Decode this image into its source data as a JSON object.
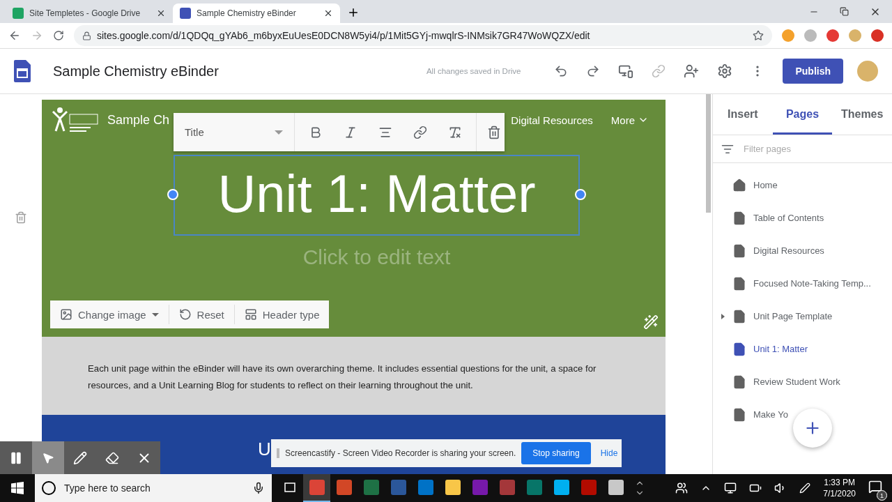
{
  "browser": {
    "tabs": [
      {
        "title": "Site Templetes - Google Drive",
        "kind": "drive",
        "selected": false
      },
      {
        "title": "Sample Chemistry eBinder",
        "kind": "sites",
        "selected": true
      }
    ],
    "url": "sites.google.com/d/1QDQq_gYAb6_m6byxEuUesE0DCN8W5yi4/p/1Mit5GYj-mwqlrS-INMsik7GR47WoWQZX/edit"
  },
  "site_header": {
    "title": "Sample Chemistry eBinder",
    "save_status": "All changes saved in Drive",
    "publish": "Publish"
  },
  "editor": {
    "site_title": "Sample Ch",
    "nav_links": [
      "Digital Resources"
    ],
    "more": "More",
    "format_toolbar": {
      "style": "Title"
    },
    "header": {
      "title": "Unit 1: Matter",
      "subtitle_placeholder": "Click to edit text",
      "buttons": [
        {
          "label": "Change image",
          "kind": "image"
        },
        {
          "label": "Reset",
          "kind": "reset"
        },
        {
          "label": "Header type",
          "kind": "header"
        }
      ]
    },
    "intro_text": "Each unit page within the eBinder will have its own overarching theme. It includes essential questions for the unit, a space for resources, and a Unit Learning Blog for students to reflect on their learning throughout the unit.",
    "section_title": "U"
  },
  "panel": {
    "tabs": [
      {
        "label": "Insert",
        "selected": false
      },
      {
        "label": "Pages",
        "selected": true
      },
      {
        "label": "Themes",
        "selected": false
      }
    ],
    "filter": {
      "placeholder": "Filter pages"
    },
    "pages": [
      {
        "label": "Home",
        "kind": "home",
        "selected": false
      },
      {
        "label": "Table of Contents",
        "kind": "page",
        "selected": false
      },
      {
        "label": "Digital Resources",
        "kind": "page",
        "selected": false
      },
      {
        "label": "Focused Note-Taking Temp...",
        "kind": "page",
        "selected": false
      },
      {
        "label": "Unit Page Template",
        "kind": "page",
        "selected": false,
        "expanded": false
      },
      {
        "label": "Unit 1: Matter",
        "kind": "page",
        "selected": true
      },
      {
        "label": "Review Student Work",
        "kind": "page",
        "selected": false
      },
      {
        "label": "Make Yo",
        "kind": "page",
        "selected": false
      }
    ]
  },
  "screencastify": {
    "message": "Screencastify - Screen Video Recorder is sharing your screen.",
    "stop": "Stop sharing",
    "hide": "Hide"
  },
  "annotation_tools": [
    {
      "kind": "pause",
      "selected": false
    },
    {
      "kind": "pointer",
      "selected": true
    },
    {
      "kind": "pen",
      "selected": false
    },
    {
      "kind": "eraser",
      "selected": false
    },
    {
      "kind": "close",
      "selected": false
    }
  ],
  "taskbar": {
    "search_placeholder": "Type here to search",
    "apps": [
      {
        "kind": "browser",
        "selected": true
      },
      {
        "kind": "slides",
        "selected": false
      },
      {
        "kind": "sheet",
        "selected": false
      },
      {
        "kind": "doc",
        "selected": false
      },
      {
        "kind": "mail",
        "selected": false
      },
      {
        "kind": "folder",
        "selected": false
      },
      {
        "kind": "notes",
        "selected": false
      },
      {
        "kind": "database",
        "selected": false
      },
      {
        "kind": "publisher",
        "selected": false
      },
      {
        "kind": "chat",
        "selected": false
      },
      {
        "kind": "pdf",
        "selected": false
      },
      {
        "kind": "snip",
        "selected": false
      }
    ],
    "time": "1:33 PM",
    "date": "7/1/2020",
    "notifications": "1"
  }
}
